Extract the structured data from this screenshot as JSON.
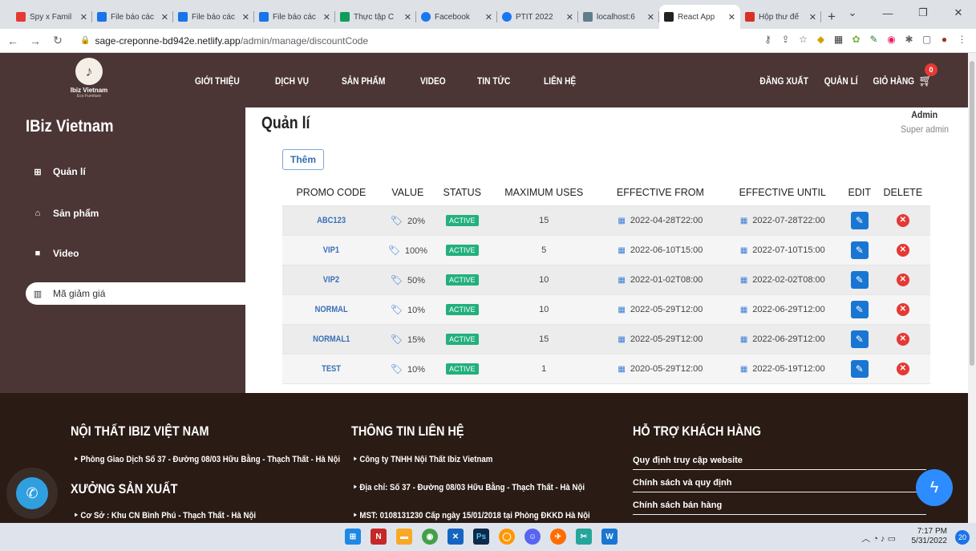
{
  "browser": {
    "tabs": [
      {
        "title": "Spy x Famil",
        "color": "#e53935"
      },
      {
        "title": "File báo các",
        "color": "#1a73e8"
      },
      {
        "title": "File báo các",
        "color": "#1a73e8"
      },
      {
        "title": "File báo các",
        "color": "#1a73e8"
      },
      {
        "title": "Thực tập C",
        "color": "#0f9d58"
      },
      {
        "title": "Facebook",
        "color": "#1877f2"
      },
      {
        "title": "PTIT 2022",
        "color": "#1877f2"
      },
      {
        "title": "localhost:6",
        "color": "#607d8b"
      },
      {
        "title": "React App",
        "color": "#222"
      },
      {
        "title": "Hộp thư đế",
        "color": "#d93025"
      }
    ],
    "url_host": "sage-creponne-bd942e.netlify.app",
    "url_path": "/admin/manage/discountCode"
  },
  "header": {
    "logo_name": "Ibiz Vietnam",
    "logo_sub": "Eco Furniture",
    "nav": [
      "GIỚI THIỆU",
      "DỊCH VỤ",
      "SẢN PHẨM",
      "VIDEO",
      "TIN TỨC",
      "LIÊN HỆ"
    ],
    "right_nav": [
      "ĐĂNG XUẤT",
      "QUẢN LÍ",
      "GIỎ HÀNG"
    ],
    "cart_count": "0"
  },
  "sidebar": {
    "brand": "IBiz Vietnam",
    "items": [
      {
        "label": "Quản lí",
        "icon": "grid-icon"
      },
      {
        "label": "Sản phẩm",
        "icon": "bag-icon"
      },
      {
        "label": "Video",
        "icon": "video-icon"
      },
      {
        "label": "Mã giảm giá",
        "icon": "barcode-icon"
      }
    ]
  },
  "user": {
    "name": "Admin",
    "role": "Super admin"
  },
  "main": {
    "title": "Quản lí",
    "add_label": "Thêm",
    "columns": [
      "PROMO CODE",
      "VALUE",
      "STATUS",
      "MAXIMUM USES",
      "EFFECTIVE FROM",
      "EFFECTIVE UNTIL",
      "EDIT",
      "DELETE"
    ],
    "rows": [
      {
        "code": "ABC123",
        "value": "20%",
        "status": "ACTIVE",
        "max": "15",
        "from": "2022-04-28T22:00",
        "until": "2022-07-28T22:00"
      },
      {
        "code": "VIP1",
        "value": "100%",
        "status": "ACTIVE",
        "max": "5",
        "from": "2022-06-10T15:00",
        "until": "2022-07-10T15:00"
      },
      {
        "code": "VIP2",
        "value": "50%",
        "status": "ACTIVE",
        "max": "10",
        "from": "2022-01-02T08:00",
        "until": "2022-02-02T08:00"
      },
      {
        "code": "NORMAL",
        "value": "10%",
        "status": "ACTIVE",
        "max": "10",
        "from": "2022-05-29T12:00",
        "until": "2022-06-29T12:00"
      },
      {
        "code": "NORMAL1",
        "value": "15%",
        "status": "ACTIVE",
        "max": "15",
        "from": "2022-05-29T12:00",
        "until": "2022-06-29T12:00"
      },
      {
        "code": "TEST",
        "value": "10%",
        "status": "ACTIVE",
        "max": "1",
        "from": "2020-05-29T12:00",
        "until": "2022-05-19T12:00"
      }
    ]
  },
  "footer": {
    "col1_title": "NỘI THẤT IBIZ VIỆT NAM",
    "col1_line": "Phòng Giao Dịch Số 37 - Đường 08/03 Hữu Bằng - Thạch Thất - Hà Nội",
    "col1_title2": "XƯỞNG SẢN XUẤT",
    "col1_line2": "Cơ Sở : Khu CN Bình Phú - Thạch Thất - Hà Nội",
    "col2_title": "THÔNG TIN LIÊN HỆ",
    "col2_lines": [
      "Công ty TNHH Nội Thất Ibiz Vietnam",
      "Địa chỉ: Số 37 - Đường 08/03 Hữu Bằng - Thạch Thất - Hà Nội",
      "MST: 0108131230 Cấp ngày 15/01/2018 tại Phòng ĐKKD Hà Nội"
    ],
    "col3_title": "HỖ TRỢ KHÁCH HÀNG",
    "col3_links": [
      "Quy định truy cập website",
      "Chính sách và quy định",
      "Chính sách bán hàng"
    ]
  },
  "taskbar": {
    "time": "7:17 PM",
    "date": "5/31/2022",
    "notifications": "20"
  },
  "colors": {
    "header_bg": "#4b3535",
    "footer_bg": "#2a1b14",
    "accent": "#1976d2",
    "status": "#22b07d"
  }
}
